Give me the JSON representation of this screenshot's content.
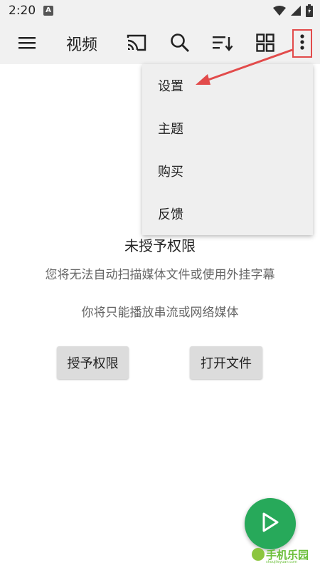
{
  "status_bar": {
    "time": "2:20",
    "notification_badge": "A",
    "icons": [
      "wifi-icon",
      "signal-icon",
      "battery-icon"
    ]
  },
  "app_bar": {
    "title": "视频",
    "actions": [
      "menu-icon",
      "cast-icon",
      "search-icon",
      "sort-icon",
      "grid-view-icon",
      "more-vert-icon"
    ]
  },
  "overflow_menu": {
    "items": [
      {
        "label": "设置"
      },
      {
        "label": "主题"
      },
      {
        "label": "购买"
      },
      {
        "label": "反馈"
      }
    ]
  },
  "permission": {
    "title": "未授予权限",
    "message_1": "您将无法自动扫描媒体文件或使用外挂字幕",
    "message_2": "你将只能播放串流或网络媒体"
  },
  "buttons": {
    "grant": "授予权限",
    "open_file": "打开文件"
  },
  "fab": {
    "icon": "play-icon"
  },
  "watermark": {
    "text": "手机乐园",
    "url": "shoujileyuan.com"
  },
  "colors": {
    "bar_bg": "#f1f1f1",
    "fab": "#27a95a",
    "annotation": "#e24b4b",
    "watermark": "#6bbf3a"
  }
}
